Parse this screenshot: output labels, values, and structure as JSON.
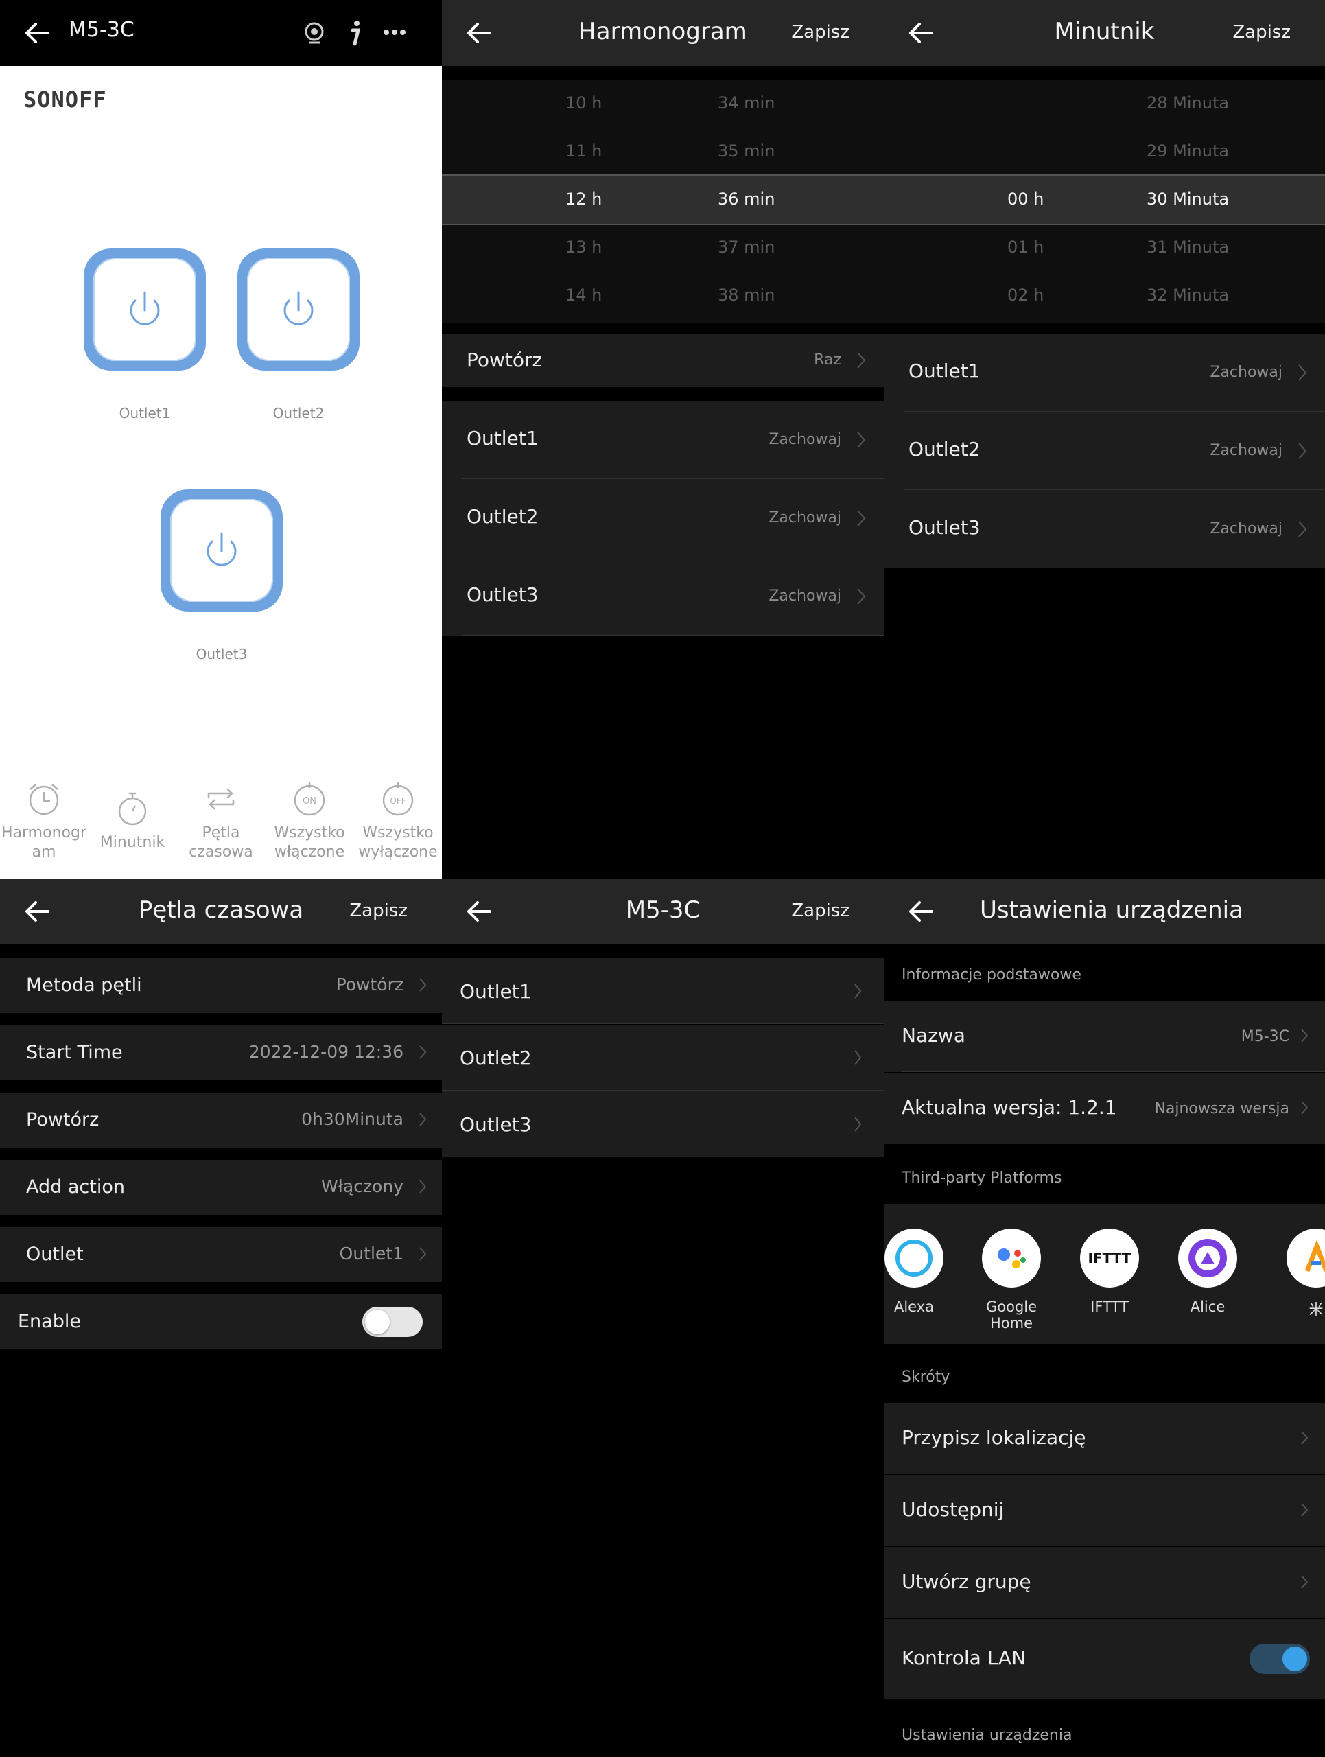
{
  "panel1": {
    "title": "M5-3C",
    "logo": "SONOFF",
    "outlets": [
      "Outlet1",
      "Outlet2",
      "Outlet3"
    ],
    "bottom_bar": [
      {
        "label1": "Harmonogr",
        "label2": "am",
        "icon": "alarm-clock-icon"
      },
      {
        "label1": "Minutnik",
        "label2": "",
        "icon": "stopwatch-icon"
      },
      {
        "label1": "Pętla",
        "label2": "czasowa",
        "icon": "loop-icon"
      },
      {
        "label1": "Wszystko",
        "label2": "włączone",
        "icon": "all-on-icon"
      },
      {
        "label1": "Wszystko",
        "label2": "wyłączone",
        "icon": "all-off-icon"
      }
    ],
    "on_text": "ON",
    "off_text": "OFF"
  },
  "panel2": {
    "title": "Harmonogram",
    "save": "Zapisz",
    "hours": [
      "10 h",
      "11 h",
      "12 h",
      "13 h",
      "14 h"
    ],
    "minutes": [
      "34 min",
      "35 min",
      "36 min",
      "37 min",
      "38 min"
    ],
    "repeat": {
      "label": "Powtórz",
      "value": "Raz"
    },
    "outlets": [
      {
        "label": "Outlet1",
        "value": "Zachowaj"
      },
      {
        "label": "Outlet2",
        "value": "Zachowaj"
      },
      {
        "label": "Outlet3",
        "value": "Zachowaj"
      }
    ]
  },
  "panel3": {
    "title": "Minutnik",
    "save": "Zapisz",
    "hours": [
      "",
      "",
      "00 h",
      "01 h",
      "02 h"
    ],
    "minutes": [
      "28 Minuta",
      "29 Minuta",
      "30 Minuta",
      "31 Minuta",
      "32 Minuta"
    ],
    "outlets": [
      {
        "label": "Outlet1",
        "value": "Zachowaj"
      },
      {
        "label": "Outlet2",
        "value": "Zachowaj"
      },
      {
        "label": "Outlet3",
        "value": "Zachowaj"
      }
    ]
  },
  "panel4": {
    "title": "Pętla czasowa",
    "save": "Zapisz",
    "rows": [
      {
        "label": "Metoda pętli",
        "value": "Powtórz"
      },
      {
        "label": "Start Time",
        "value": "2022-12-09 12:36"
      },
      {
        "label": "Powtórz",
        "value": "0h30Minuta"
      },
      {
        "label": "Add action",
        "value": "Włączony"
      },
      {
        "label": "Outlet",
        "value": "Outlet1"
      }
    ],
    "enable_label": "Enable",
    "enable_on": false
  },
  "panel5": {
    "title": "M5-3C",
    "save": "Zapisz",
    "outlets": [
      "Outlet1",
      "Outlet2",
      "Outlet3"
    ]
  },
  "panel6": {
    "title": "Ustawienia urządzenia",
    "section_basic": "Informacje podstawowe",
    "name_label": "Nazwa",
    "name_value": "M5-3C",
    "version_label": "Aktualna wersja:  1.2.1",
    "version_value": "Najnowsza wersja",
    "section_platforms": "Third-party Platforms",
    "platforms": [
      "Alexa",
      "Google Home",
      "IFTTT",
      "Alice",
      "米"
    ],
    "ifttt_logo": "IFTTT",
    "section_shortcuts": "Skróty",
    "shortcuts": [
      "Przypisz lokalizację",
      "Udostępnij",
      "Utwórz grupę"
    ],
    "lan_label": "Kontrola LAN",
    "lan_on": true,
    "section_device": "Ustawienia urządzenia",
    "colors": {
      "accent": "#3aa0e8",
      "outlet": "#6ea3df"
    }
  }
}
